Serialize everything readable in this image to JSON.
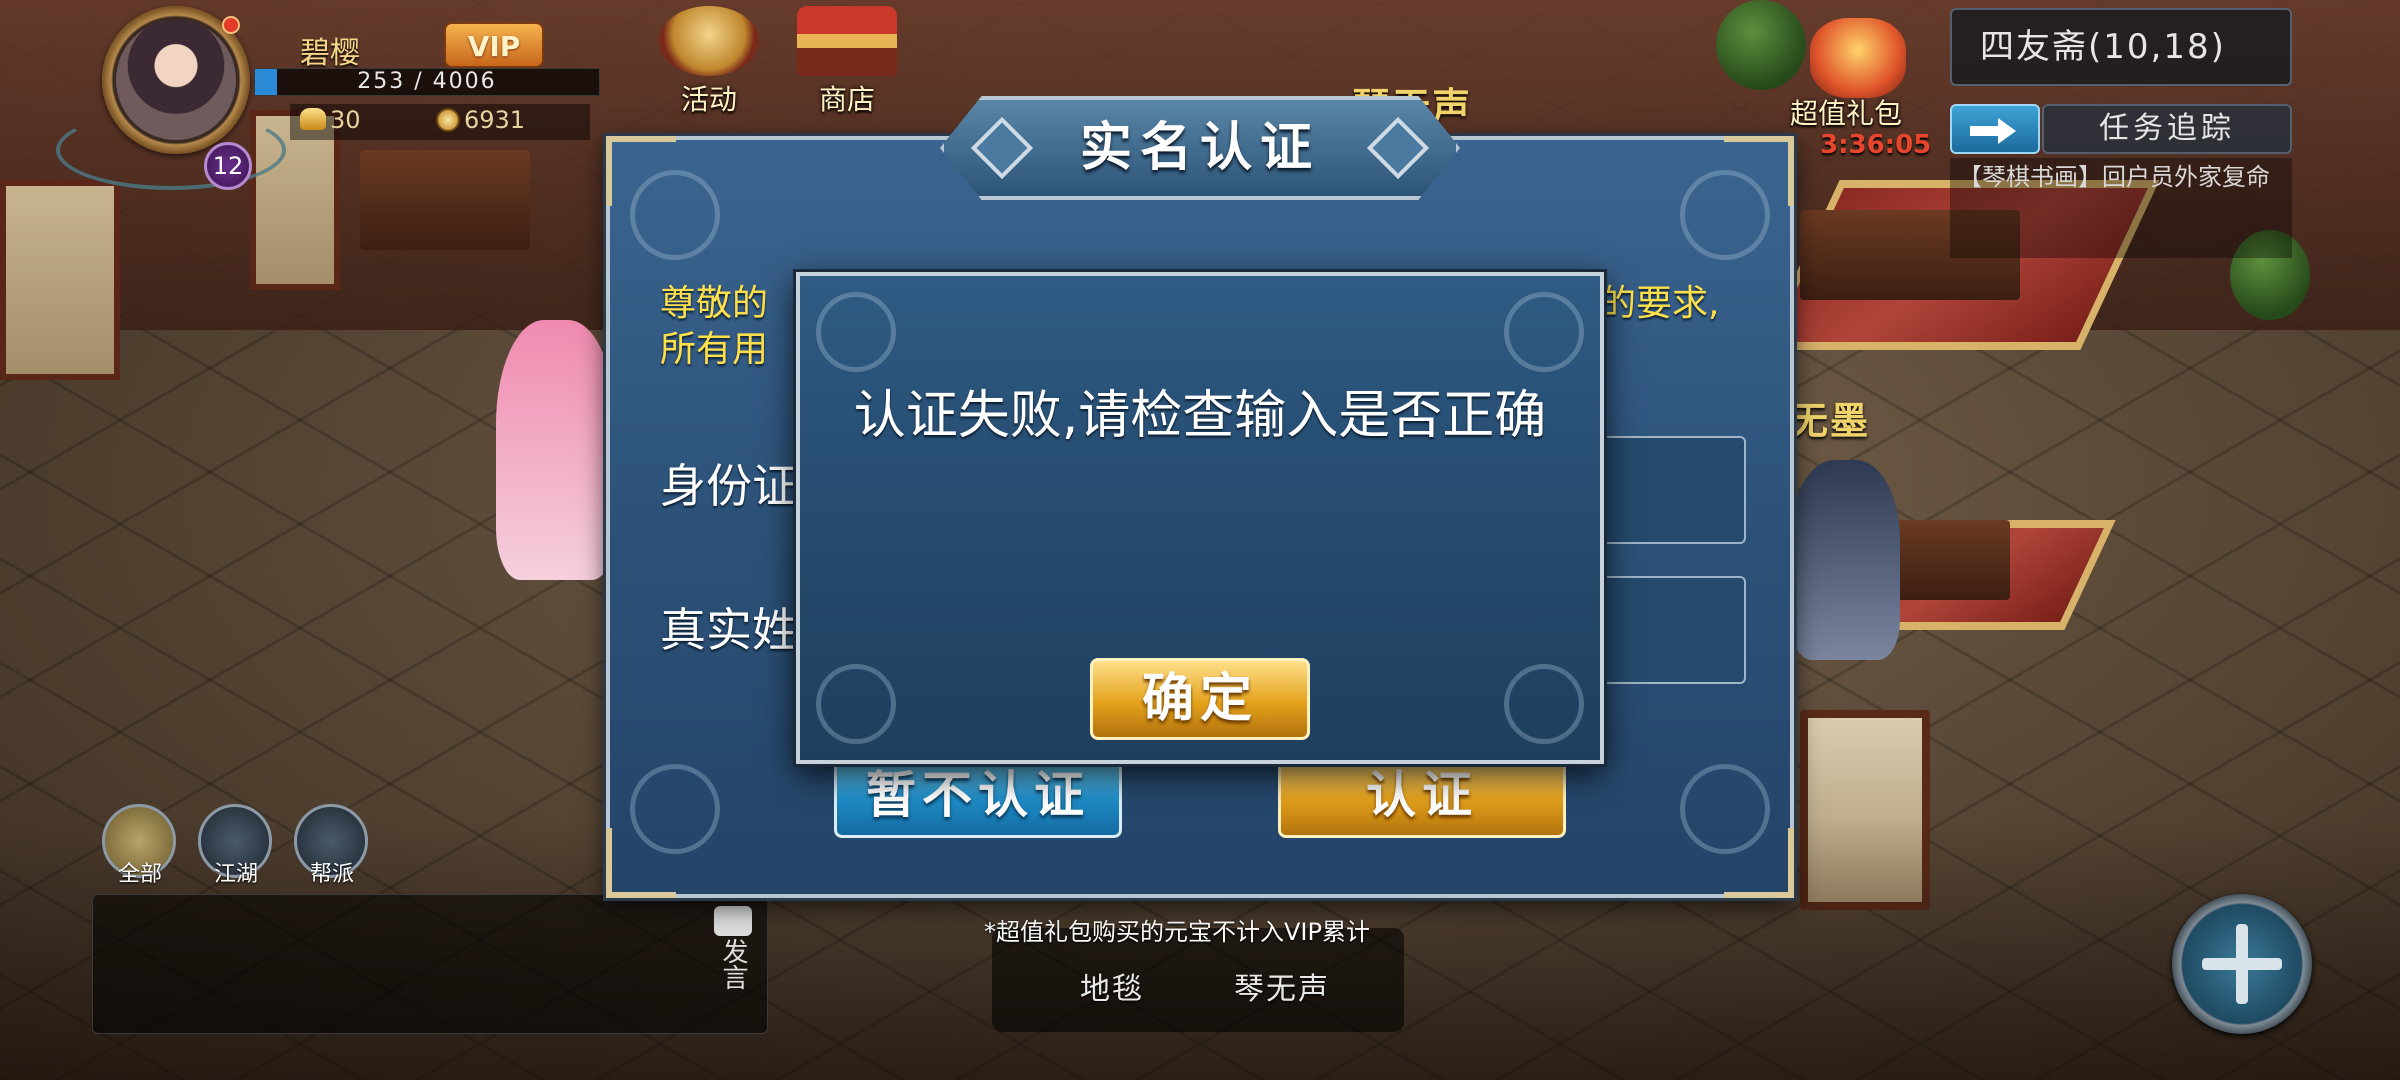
{
  "player": {
    "name": "碧樱",
    "vip_label": "VIP",
    "hp_text": "253 / 4006",
    "hp_fraction": 0.063,
    "level": "12",
    "gold": "30",
    "coins": "6931"
  },
  "top_menu": [
    {
      "label": "活动",
      "icon": "drum-icon"
    },
    {
      "label": "商店",
      "icon": "shop-icon"
    }
  ],
  "gift_pack": {
    "label": "超值礼包",
    "timer": "3:36:05",
    "icon": "gift-icon"
  },
  "location": {
    "text": "四友斋(10,18)"
  },
  "task_tracker": {
    "title": "任务追踪",
    "description": "【琴棋书画】回户员外家复命"
  },
  "npc_tags": [
    "琴无声",
    "书无墨"
  ],
  "chat": {
    "tabs": [
      "全部",
      "江湖",
      "帮派"
    ],
    "speak_label": "发言"
  },
  "quick_bar": {
    "notice": "*超值礼包购买的元宝不计入VIP累计",
    "items": [
      "地毯",
      "琴无声"
    ]
  },
  "verify_dialog": {
    "title": "实名认证",
    "notice_line1": "尊敬的",
    "notice_line1_tail": "的要求,",
    "notice_line2": "所有用",
    "id_label": "身份证",
    "name_label": "真实姓",
    "skip_button": "暂不认证",
    "verify_button": "认证"
  },
  "error_popup": {
    "message": "认证失败,请检查输入是否正确",
    "confirm_button": "确定"
  },
  "colors": {
    "dialog_blue": "#2c5279",
    "gold_button": "#e4a21c",
    "blue_button": "#1f8ec9",
    "notice_yellow": "#ffe04a",
    "npc_tag": "#f0d36a",
    "timer_red": "#e8452d"
  }
}
